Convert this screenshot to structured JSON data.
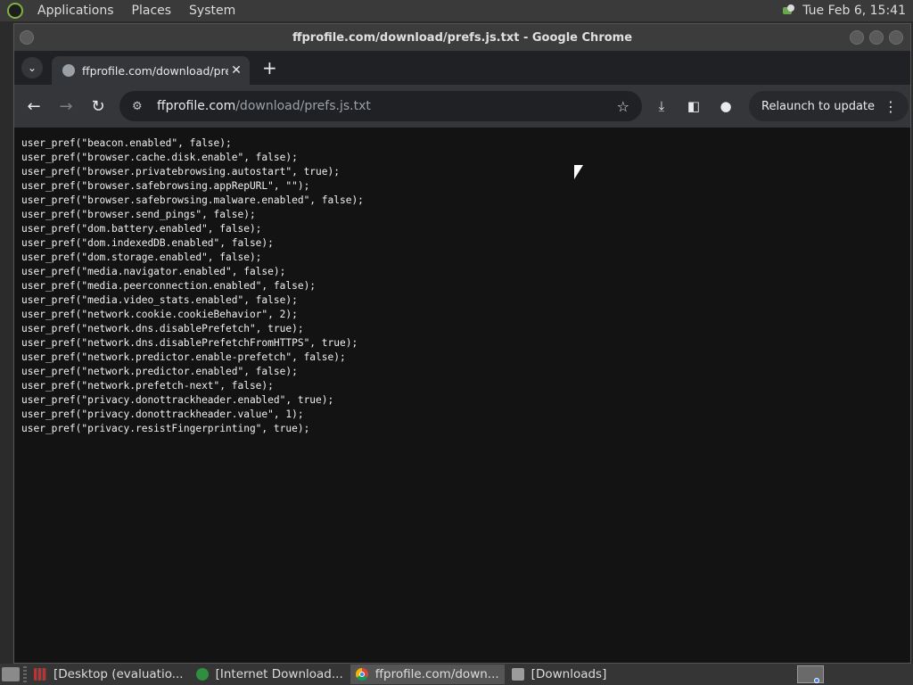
{
  "top_panel": {
    "menus": [
      "Applications",
      "Places",
      "System"
    ],
    "clock": "Tue Feb  6, 15:41"
  },
  "window": {
    "title": "ffprofile.com/download/prefs.js.txt - Google Chrome",
    "tab": {
      "title": "ffprofile.com/download/prefs.js.txt",
      "close": "✕"
    },
    "new_tab": "+",
    "omnibox": {
      "host": "ffprofile.com",
      "path": "/download/prefs.js.txt"
    },
    "relaunch_label": "Relaunch to update"
  },
  "content_lines": [
    "user_pref(\"beacon.enabled\", false);",
    "user_pref(\"browser.cache.disk.enable\", false);",
    "user_pref(\"browser.privatebrowsing.autostart\", true);",
    "user_pref(\"browser.safebrowsing.appRepURL\", \"\");",
    "user_pref(\"browser.safebrowsing.malware.enabled\", false);",
    "user_pref(\"browser.send_pings\", false);",
    "user_pref(\"dom.battery.enabled\", false);",
    "user_pref(\"dom.indexedDB.enabled\", false);",
    "user_pref(\"dom.storage.enabled\", false);",
    "user_pref(\"media.navigator.enabled\", false);",
    "user_pref(\"media.peerconnection.enabled\", false);",
    "user_pref(\"media.video_stats.enabled\", false);",
    "user_pref(\"network.cookie.cookieBehavior\", 2);",
    "user_pref(\"network.dns.disablePrefetch\", true);",
    "user_pref(\"network.dns.disablePrefetchFromHTTPS\", true);",
    "user_pref(\"network.predictor.enable-prefetch\", false);",
    "user_pref(\"network.predictor.enabled\", false);",
    "user_pref(\"network.prefetch-next\", false);",
    "user_pref(\"privacy.donottrackheader.enabled\", true);",
    "user_pref(\"privacy.donottrackheader.value\", 1);",
    "user_pref(\"privacy.resistFingerprinting\", true);"
  ],
  "taskbar": {
    "tasks": [
      {
        "label": "[Desktop (evaluatio...",
        "icon": "terminal-icon"
      },
      {
        "label": "[Internet Download...",
        "icon": "idm-icon"
      },
      {
        "label": "ffprofile.com/down...",
        "icon": "chrome-icon"
      },
      {
        "label": "[Downloads]",
        "icon": "folder-icon"
      }
    ]
  }
}
